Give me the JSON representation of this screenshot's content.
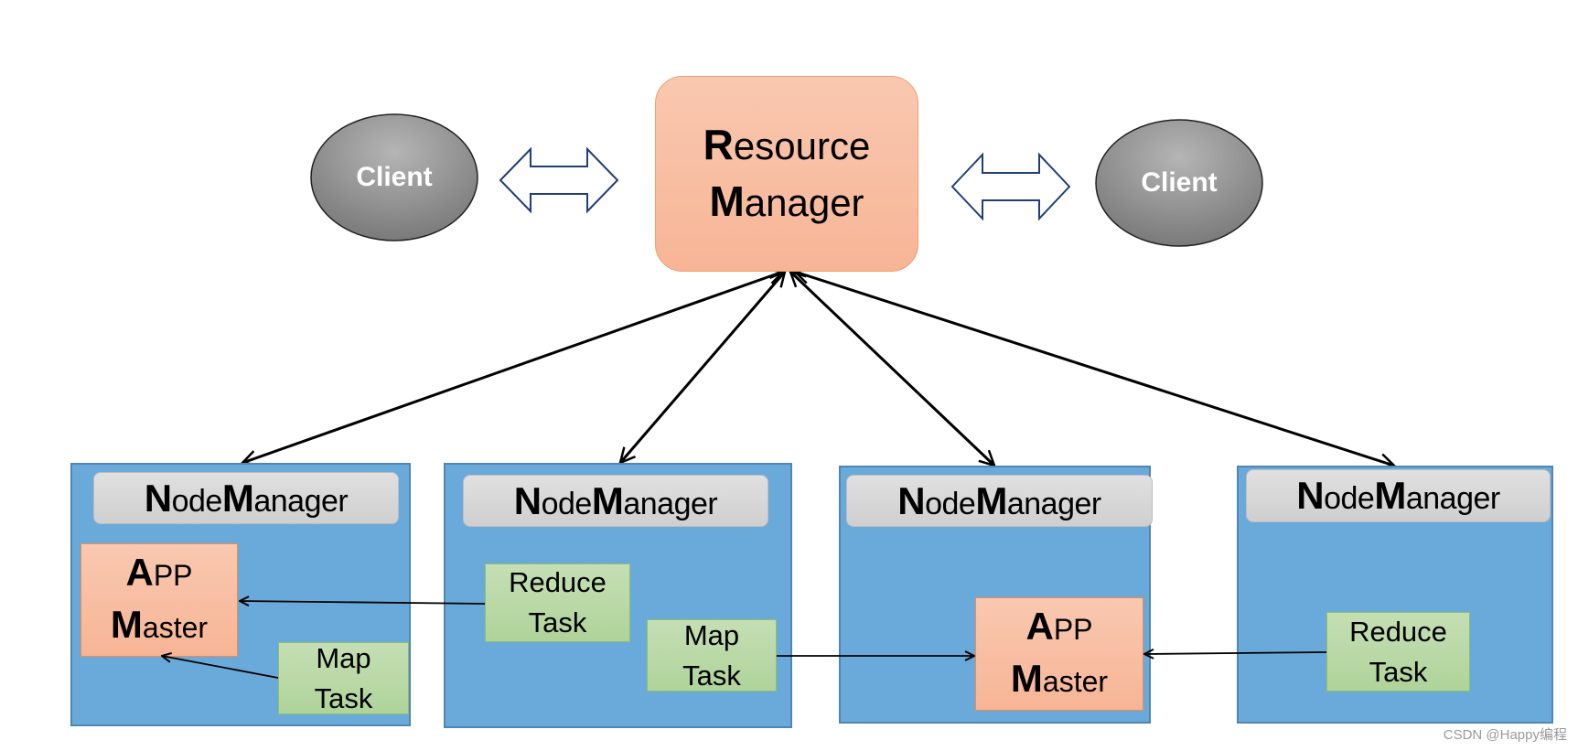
{
  "resource_manager": {
    "first_letter_1": "R",
    "rest_1": "esource",
    "first_letter_2": "M",
    "rest_2": "anager"
  },
  "clients": [
    {
      "label": "Client"
    },
    {
      "label": "Client"
    }
  ],
  "node_managers": [
    {
      "initial_1": "N",
      "rest_1": "ode",
      "initial_2": "M",
      "rest_2": "anager"
    },
    {
      "initial_1": "N",
      "rest_1": "ode",
      "initial_2": "M",
      "rest_2": "anager"
    },
    {
      "initial_1": "N",
      "rest_1": "ode",
      "initial_2": "M",
      "rest_2": "anager"
    },
    {
      "initial_1": "N",
      "rest_1": "ode",
      "initial_2": "M",
      "rest_2": "anager"
    }
  ],
  "app_master": {
    "initial_1": "A",
    "rest_1": "PP",
    "initial_2": "M",
    "rest_2": "aster"
  },
  "tasks": {
    "reduce_line1": "Reduce",
    "map_line1": "Map",
    "line2": "Task"
  },
  "watermark": "CSDN @Happy编程",
  "colors": {
    "node_manager": "#6aaada",
    "app_master": "#f7b596",
    "task": "#b8d9a4",
    "client": "#8a8a8a",
    "arrow_outline": "#1f3f7a"
  }
}
